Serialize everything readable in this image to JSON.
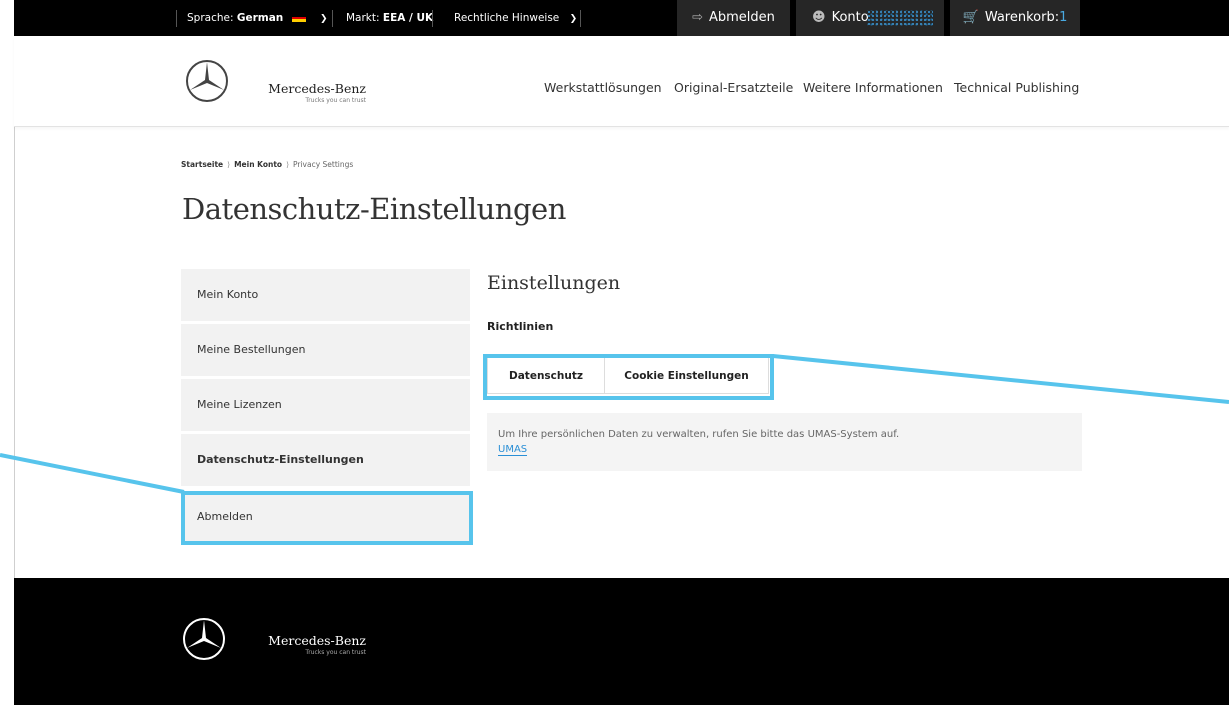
{
  "topbar": {
    "language_label": "Sprache:",
    "language_value": "German",
    "market_label": "Markt:",
    "market_value": "EEA / UK",
    "legal_label": "Rechtliche Hinweise",
    "logout_label": "Abmelden",
    "account_label": "Konto",
    "cart_label": "Warenkorb:",
    "cart_count": "1"
  },
  "header": {
    "brand_name": "Mercedes-Benz",
    "brand_tagline": "Trucks you can trust",
    "nav": [
      "Werkstattlösungen",
      "Original-Ersatzteile",
      "Weitere Informationen",
      "Technical Publishing"
    ]
  },
  "breadcrumb": {
    "items": [
      "Startseite",
      "Mein Konto",
      "Privacy Settings"
    ]
  },
  "page": {
    "title": "Datenschutz-Einstellungen"
  },
  "sidebar": {
    "items": [
      "Mein Konto",
      "Meine Bestellungen",
      "Meine Lizenzen",
      "Datenschutz-Einstellungen",
      "Abmelden"
    ],
    "active_index": 3
  },
  "content": {
    "section_title": "Einstellungen",
    "subtitle": "Richtlinien",
    "tabs": [
      "Datenschutz",
      "Cookie Einstellungen"
    ],
    "info_text": "Um Ihre persönlichen Daten zu verwalten, rufen Sie bitte das UMAS-System auf.",
    "info_link": "UMAS"
  },
  "footer": {
    "brand_name": "Mercedes-Benz",
    "brand_tagline": "Trucks you can trust"
  },
  "colors": {
    "highlight": "#57c4ec",
    "link": "#2a8fd6",
    "topbar_bg": "#000000"
  }
}
